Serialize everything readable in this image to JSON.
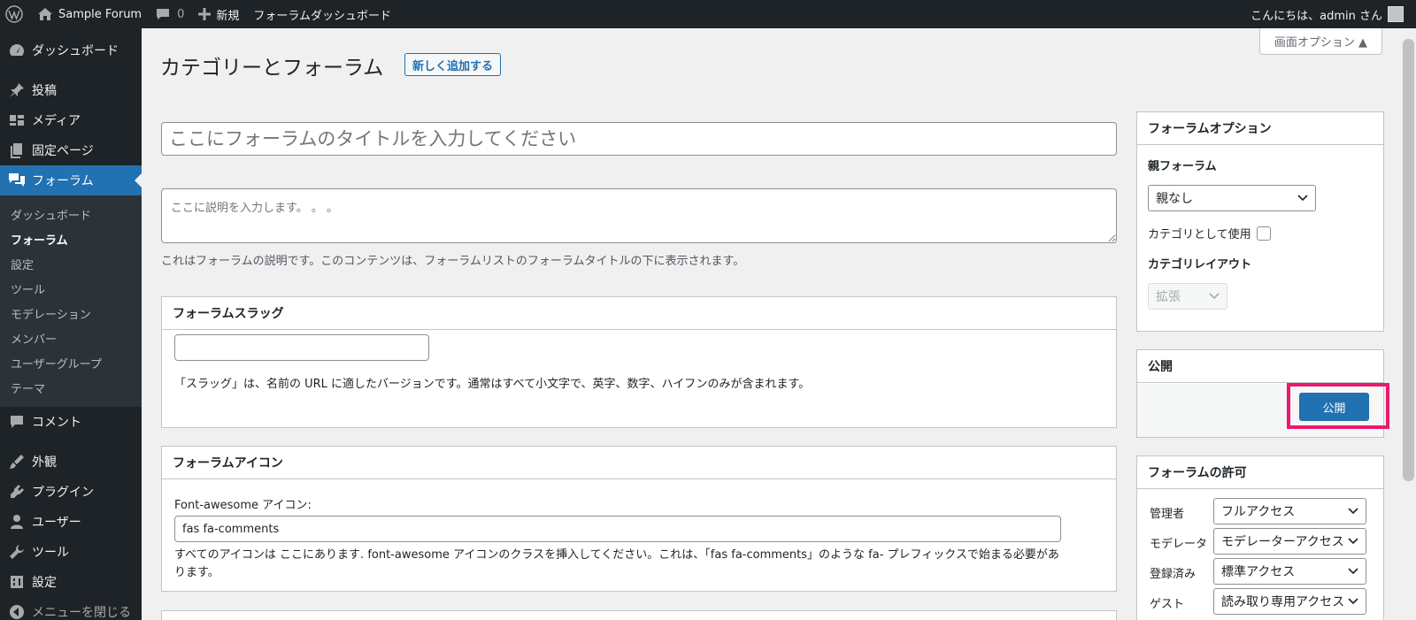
{
  "adminbar": {
    "site_name": "Sample Forum",
    "comments_count": "0",
    "new_label": "新規",
    "forum_dashboard": "フォーラムダッシュボード",
    "greeting": "こんにちは、admin さん"
  },
  "sidebar": {
    "items": [
      {
        "label": "ダッシュボード",
        "icon": "dashboard-icon"
      },
      {
        "label": "投稿",
        "icon": "pin-icon"
      },
      {
        "label": "メディア",
        "icon": "media-icon"
      },
      {
        "label": "固定ページ",
        "icon": "page-icon"
      },
      {
        "label": "フォーラム",
        "icon": "forum-icon"
      },
      {
        "label": "コメント",
        "icon": "comment-icon"
      },
      {
        "label": "外観",
        "icon": "brush-icon"
      },
      {
        "label": "プラグイン",
        "icon": "plugin-icon"
      },
      {
        "label": "ユーザー",
        "icon": "user-icon"
      },
      {
        "label": "ツール",
        "icon": "wrench-icon"
      },
      {
        "label": "設定",
        "icon": "settings-icon"
      },
      {
        "label": "メニューを閉じる",
        "icon": "collapse-icon"
      }
    ],
    "submenu": [
      "ダッシュボード",
      "フォーラム",
      "設定",
      "ツール",
      "モデレーション",
      "メンバー",
      "ユーザーグループ",
      "テーマ"
    ]
  },
  "screen_options": "画面オプション ▲",
  "page": {
    "title": "カテゴリーとフォーラム",
    "add_new": "新しく追加する",
    "title_placeholder": "ここにフォーラムのタイトルを入力してください",
    "desc_placeholder": "ここに説明を入力します。 。 。",
    "desc_help": "これはフォーラムの説明です。このコンテンツは、フォーラムリストのフォーラムタイトルの下に表示されます。"
  },
  "slug_box": {
    "title": "フォーラムスラッグ",
    "value": "",
    "help": "「スラッグ」は、名前の URL に適したバージョンです。通常はすべて小文字で、英字、数字、ハイフンのみが含まれます。"
  },
  "icon_box": {
    "title": "フォーラムアイコン",
    "label": "Font-awesome アイコン:",
    "value": "fas fa-comments",
    "help": "すべてのアイコンは ここにあります. font-awesome アイコンのクラスを挿入してください。これは、「fas fa-comments」のような fa- プレフィックスで始まる必要があります。"
  },
  "options_box": {
    "title": "フォーラムオプション",
    "parent_label": "親フォーラム",
    "parent_value": "親なし",
    "category_label": "カテゴリとして使用",
    "layout_label": "カテゴリレイアウト",
    "layout_value": "拡張"
  },
  "publish_box": {
    "title": "公開",
    "button": "公開"
  },
  "perm_box": {
    "title": "フォーラムの許可",
    "rows": [
      {
        "role": "管理者",
        "value": "フルアクセス"
      },
      {
        "role": "モデレータ",
        "value": "モデレーターアクセス"
      },
      {
        "role": "登録済み",
        "value": "標準アクセス"
      },
      {
        "role": "ゲスト",
        "value": "読み取り専用アクセス"
      }
    ]
  },
  "colors": {
    "accent": "#2271b1",
    "sidebar_bg": "#1d2327",
    "highlight": "#ea1a6f"
  }
}
